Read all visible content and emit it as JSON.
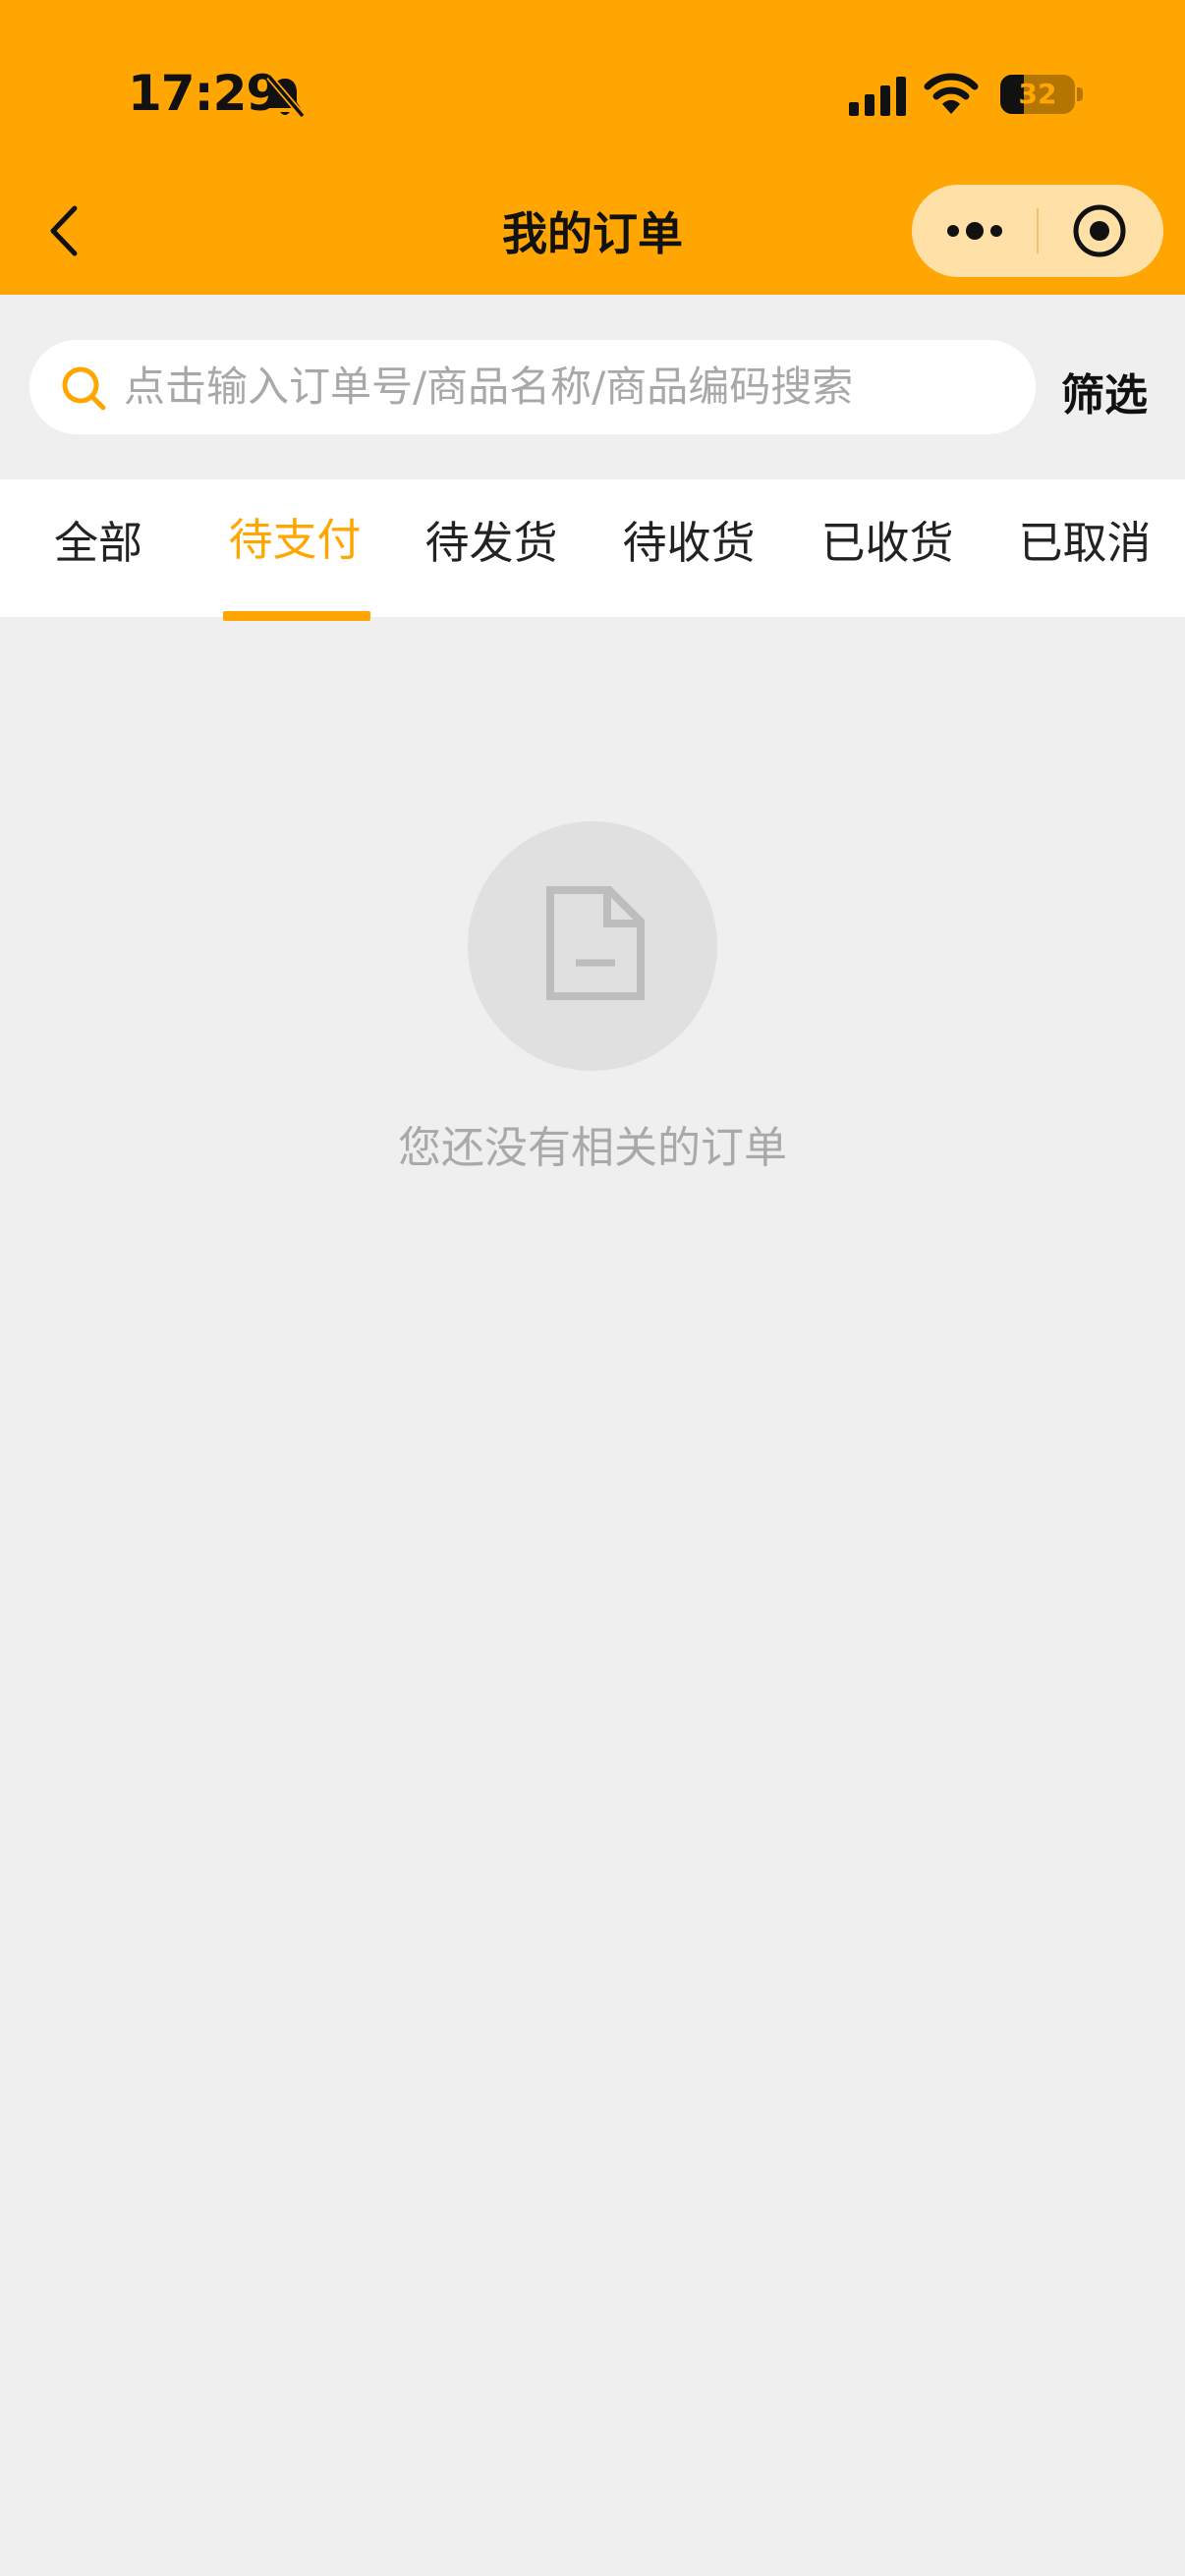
{
  "status_bar": {
    "time": "17:29",
    "battery": "32",
    "battery_level_percent": 32,
    "icons": [
      "bell-off-icon",
      "signal-icon",
      "wifi-icon",
      "battery-icon"
    ]
  },
  "header": {
    "title": "我的订单",
    "background_color": "#ffa602",
    "icons": [
      "back-icon",
      "more-icon",
      "target-icon"
    ]
  },
  "search": {
    "placeholder": "点击输入订单号/商品名称/商品编码搜索",
    "filter_label": "筛选"
  },
  "tabs": {
    "items": [
      {
        "label": "全部"
      },
      {
        "label": "待支付"
      },
      {
        "label": "待发货"
      },
      {
        "label": "待收货"
      },
      {
        "label": "已收货"
      },
      {
        "label": "已取消"
      }
    ],
    "active_index": 1,
    "accent_color": "#ffa602"
  },
  "empty_state": {
    "icon": "document-icon",
    "message": "您还没有相关的订单"
  }
}
